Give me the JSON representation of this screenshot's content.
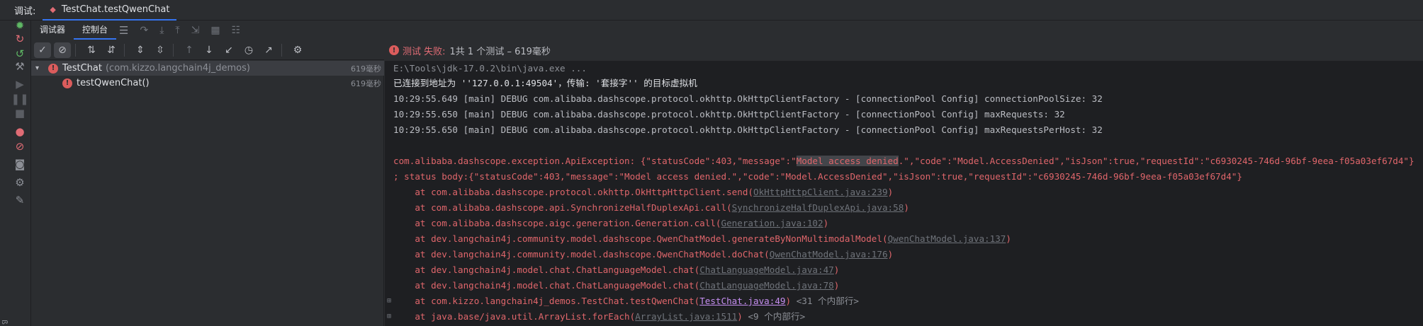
{
  "topbar": {
    "run_label": "调试:",
    "tab_label": "TestChat.testQwenChat",
    "tab_icon": "test-icon"
  },
  "left_toolbar": {
    "icons": [
      "bug-icon",
      "rerun-failed-icon",
      "rerun-icon",
      "wrench-icon",
      "resume-icon",
      "pause-icon",
      "stop-icon",
      "breakpoint-icon",
      "mute-breakpoints-icon",
      "camera-icon",
      "settings-icon",
      "pin-icon"
    ],
    "edge_char": "ß"
  },
  "subtabs": {
    "debugger": "调试器",
    "console": "控制台"
  },
  "test_toolbar": {
    "icons": [
      "check-icon",
      "stop-circle-icon",
      "sort-alpha-icon",
      "sort-duration-icon",
      "expand-all-icon",
      "collapse-all-icon",
      "up-arrow-icon",
      "down-arrow-icon",
      "import-icon",
      "history-icon",
      "export-icon",
      "gear-icon"
    ]
  },
  "tree": {
    "rows": [
      {
        "name": "TestChat",
        "sub": "(com.kizzo.langchain4j_demos)",
        "time": "619毫秒"
      },
      {
        "name": "testQwenChat()",
        "sub": "",
        "time": "619毫秒"
      }
    ]
  },
  "status": {
    "fail_label": "测试 失败:",
    "rest": "1共 1 个测试 – 619毫秒"
  },
  "console": {
    "l1": "E:\\Tools\\jdk-17.0.2\\bin\\java.exe ...",
    "l2": "已连接到地址为 ''127.0.0.1:49504'，传输: '套接字'' 的目标虚拟机",
    "l3": "10:29:55.649 [main] DEBUG com.alibaba.dashscope.protocol.okhttp.OkHttpClientFactory - [connectionPool Config] connectionPoolSize: 32",
    "l4": "10:29:55.650 [main] DEBUG com.alibaba.dashscope.protocol.okhttp.OkHttpClientFactory - [connectionPool Config] maxRequests: 32",
    "l5": "10:29:55.650 [main] DEBUG com.alibaba.dashscope.protocol.okhttp.OkHttpClientFactory - [connectionPool Config] maxRequestsPerHost: 32",
    "l6_a": "com.alibaba.dashscope.exception.ApiException: {\"statusCode\":403,\"message\":\"",
    "l6_hl": "Model access denied",
    "l6_b": ".\",\"code\":\"Model.AccessDenied\",\"isJson\":true,\"requestId\":\"c6930245-746d-96bf-9eea-f05a03ef67d4\"}",
    "l7": "; status body:{\"statusCode\":403,\"message\":\"Model access denied.\",\"code\":\"Model.AccessDenied\",\"isJson\":true,\"requestId\":\"c6930245-746d-96bf-9eea-f05a03ef67d4\"}",
    "s1_pre": "    at com.alibaba.dashscope.protocol.okhttp.OkHttpHttpClient.send(",
    "s1_link": "OkHttpHttpClient.java:239",
    "s2_pre": "    at com.alibaba.dashscope.api.SynchronizeHalfDuplexApi.call(",
    "s2_link": "SynchronizeHalfDuplexApi.java:58",
    "s3_pre": "    at com.alibaba.dashscope.aigc.generation.Generation.call(",
    "s3_link": "Generation.java:102",
    "s4_pre": "    at dev.langchain4j.community.model.dashscope.QwenChatModel.generateByNonMultimodalModel(",
    "s4_link": "QwenChatModel.java:137",
    "s5_pre": "    at dev.langchain4j.community.model.dashscope.QwenChatModel.doChat(",
    "s5_link": "QwenChatModel.java:176",
    "s6_pre": "    at dev.langchain4j.model.chat.ChatLanguageModel.chat(",
    "s6_link": "ChatLanguageModel.java:47",
    "s7_pre": "    at dev.langchain4j.model.chat.ChatLanguageModel.chat(",
    "s7_link": "ChatLanguageModel.java:78",
    "s8_pre": "    at com.kizzo.langchain4j_demos.TestChat.testQwenChat(",
    "s8_link": "TestChat.java:49",
    "s8_fold": " <31 个内部行>",
    "s9_pre": "    at java.base/java.util.ArrayList.forEach(",
    "s9_link": "ArrayList.java:1511",
    "s9_fold": " <9 个内部行>",
    "close": ")",
    "gutter": "⊞"
  },
  "colors": {
    "accent": "#3574f0",
    "error": "#db5c5c",
    "console_bg": "#1e1f22",
    "panel_bg": "#2b2d30"
  }
}
